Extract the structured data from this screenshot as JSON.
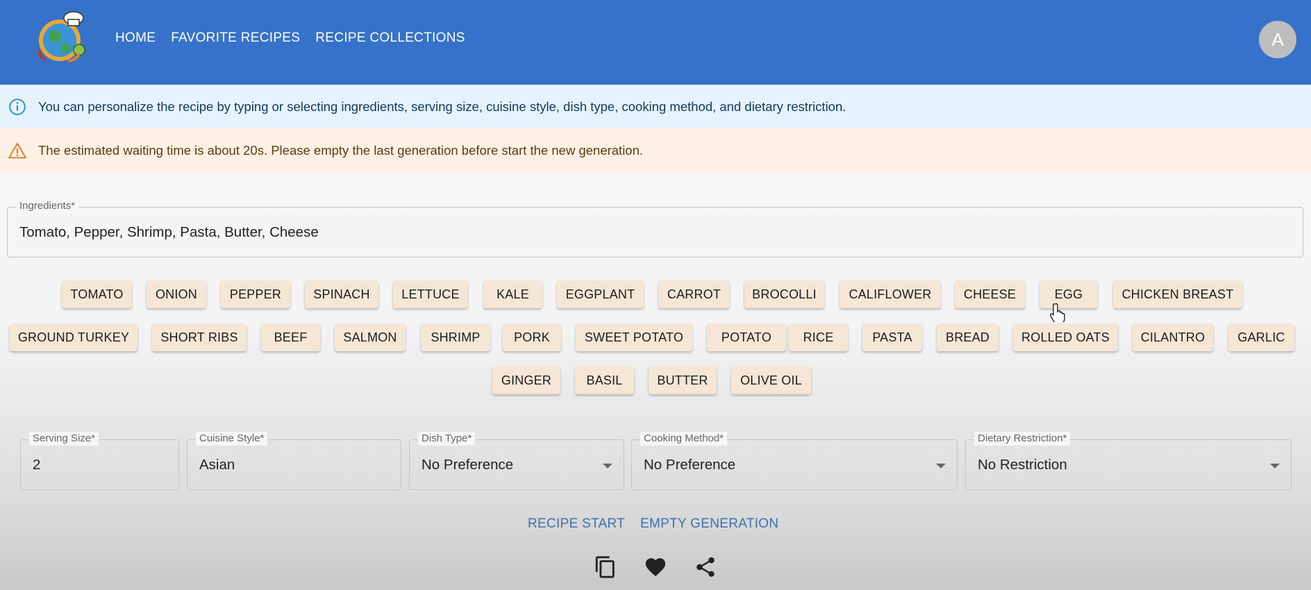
{
  "header": {
    "nav": [
      "HOME",
      "FAVORITE RECIPES",
      "RECIPE COLLECTIONS"
    ],
    "avatar_letter": "A",
    "logo_icon": "globe-chef-logo-icon"
  },
  "alerts": {
    "info": "You can personalize the recipe by typing or selecting ingredients, serving size, cuisine style, dish type, cooking method, and dietary restriction.",
    "warning": "The estimated waiting time is about 20s. Please empty the last generation before start the new generation."
  },
  "ingredients_field": {
    "label": "Ingredients",
    "required_mark": "*",
    "value": "Tomato, Pepper, Shrimp, Pasta, Butter, Cheese"
  },
  "chips": [
    "TOMATO",
    "ONION",
    "PEPPER",
    "SPINACH",
    "LETTUCE",
    "KALE",
    "EGGPLANT",
    "CARROT",
    "BROCOLLI",
    "CALIFLOWER",
    "CHEESE",
    "EGG",
    "CHICKEN BREAST",
    "GROUND TURKEY",
    "SHORT RIBS",
    "BEEF",
    "SALMON",
    "SHRIMP",
    "PORK",
    "SWEET POTATO",
    "POTATO",
    "RICE",
    "PASTA",
    "BREAD",
    "ROLLED OATS",
    "CILANTRO",
    "GARLIC",
    "GINGER",
    "BASIL",
    "BUTTER",
    "OLIVE OIL"
  ],
  "options": {
    "serving_size": {
      "label": "Serving Size",
      "value": "2"
    },
    "cuisine_style": {
      "label": "Cuisine Style",
      "value": "Asian"
    },
    "dish_type": {
      "label": "Dish Type",
      "value": "No Preference"
    },
    "cooking_method": {
      "label": "Cooking Method",
      "value": "No Preference"
    },
    "dietary_restriction": {
      "label": "Dietary Restriction",
      "value": "No Restriction"
    }
  },
  "actions": {
    "start": "RECIPE START",
    "empty": "EMPTY GENERATION",
    "icons": [
      "copy-icon",
      "heart-icon",
      "share-icon"
    ]
  },
  "colors": {
    "appbar": "#3672ca",
    "info_bg": "#e5f3fd",
    "warning_bg": "#fdf1e5",
    "chip_bg": "#f5e6d6",
    "button_text": "#3f6fad"
  }
}
